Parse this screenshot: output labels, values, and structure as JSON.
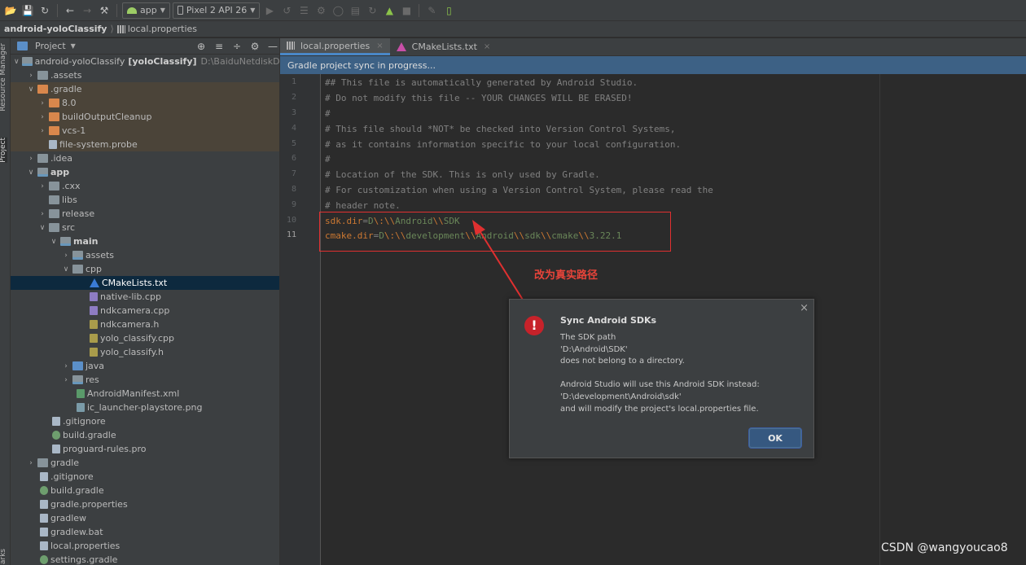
{
  "toolbar": {
    "run_config": "app",
    "device": "Pixel 2 API 26",
    "icons": [
      "open-folder-icon",
      "save-icon",
      "sync-icon",
      "back-icon",
      "forward-icon",
      "hammer-icon",
      "run-icon",
      "rerun-icon",
      "coverage-icon",
      "debug-icon",
      "profile-icon",
      "attach-icon",
      "apply-changes-icon",
      "stop-icon",
      "sdk-manager-icon",
      "device-manager-icon"
    ]
  },
  "breadcrumb": {
    "project": "android-yoloClassify",
    "file": "local.properties"
  },
  "side_tabs": {
    "resource_manager": "Resource Manager",
    "project": "Project",
    "bookmarks": "arks"
  },
  "project_panel": {
    "view_mode": "Project",
    "tree": [
      {
        "label": "android-yoloClassify",
        "extra_bold": "[yoloClassify]",
        "path": "D:\\BaiduNetdiskDownlo"
      },
      {
        "label": ".assets"
      },
      {
        "label": ".gradle"
      },
      {
        "label": "8.0"
      },
      {
        "label": "buildOutputCleanup"
      },
      {
        "label": "vcs-1"
      },
      {
        "label": "file-system.probe"
      },
      {
        "label": ".idea"
      },
      {
        "label": "app"
      },
      {
        "label": ".cxx"
      },
      {
        "label": "libs"
      },
      {
        "label": "release"
      },
      {
        "label": "src"
      },
      {
        "label": "main"
      },
      {
        "label": "assets"
      },
      {
        "label": "cpp"
      },
      {
        "label": "CMakeLists.txt"
      },
      {
        "label": "native-lib.cpp"
      },
      {
        "label": "ndkcamera.cpp"
      },
      {
        "label": "ndkcamera.h"
      },
      {
        "label": "yolo_classify.cpp"
      },
      {
        "label": "yolo_classify.h"
      },
      {
        "label": "java"
      },
      {
        "label": "res"
      },
      {
        "label": "AndroidManifest.xml"
      },
      {
        "label": "ic_launcher-playstore.png"
      },
      {
        "label": ".gitignore"
      },
      {
        "label": "build.gradle"
      },
      {
        "label": "proguard-rules.pro"
      },
      {
        "label": "gradle"
      },
      {
        "label": ".gitignore"
      },
      {
        "label": "build.gradle"
      },
      {
        "label": "gradle.properties"
      },
      {
        "label": "gradlew"
      },
      {
        "label": "gradlew.bat"
      },
      {
        "label": "local.properties"
      },
      {
        "label": "settings.gradle"
      }
    ]
  },
  "editor": {
    "tabs": [
      {
        "label": "local.properties",
        "active": true
      },
      {
        "label": "CMakeLists.txt",
        "active": false
      }
    ],
    "banner": "Gradle project sync in progress...",
    "lines": [
      "## This file is automatically generated by Android Studio.",
      "# Do not modify this file -- YOUR CHANGES WILL BE ERASED!",
      "#",
      "# This file should *NOT* be checked into Version Control Systems,",
      "# as it contains information specific to your local configuration.",
      "#",
      "# Location of the SDK. This is only used by Gradle.",
      "# For customization when using a Version Control System, please read the",
      "# header note."
    ],
    "line10": {
      "key": "sdk.dir",
      "eq": "=",
      "v1": "D",
      "e1": "\\:",
      "s1": "\\\\",
      "v2": "Android",
      "s2": "\\\\",
      "v3": "SDK"
    },
    "line11": {
      "key": "cmake.dir",
      "eq": "=",
      "v1": "D",
      "e1": "\\:",
      "s1": "\\\\",
      "v2": "development",
      "s2": "\\\\",
      "v3": "Android",
      "s3": "\\\\",
      "v4": "sdk",
      "s4": "\\\\",
      "v5": "cmake",
      "s5": "\\\\",
      "v6": "3.22.1"
    },
    "line_numbers": [
      "1",
      "2",
      "3",
      "4",
      "5",
      "6",
      "7",
      "8",
      "9",
      "10",
      "11"
    ]
  },
  "annotation": "改为真实路径",
  "dialog": {
    "title": "Sync Android SDKs",
    "icon_symbol": "!",
    "lines": [
      "The SDK path",
      "'D:\\Android\\SDK'",
      "does not belong to a directory.",
      "",
      "Android Studio will use this Android SDK instead:",
      "'D:\\development\\Android\\sdk'",
      "and will modify the project's local.properties file."
    ],
    "ok_label": "OK",
    "close_glyph": "×"
  },
  "watermark": "CSDN @wangyoucao8",
  "colors": {
    "accent": "#4a88c7",
    "banner": "#3d6185",
    "annotation_red": "#e03030",
    "error_icon": "#c7222a"
  }
}
